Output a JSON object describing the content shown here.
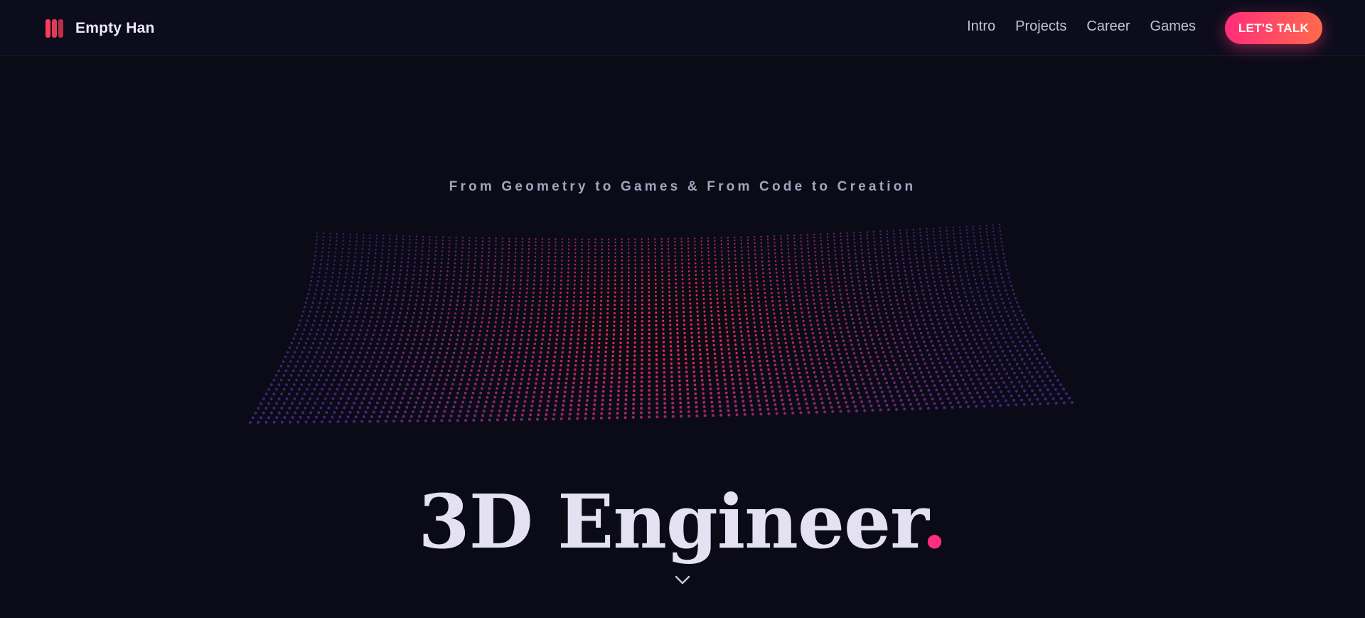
{
  "header": {
    "brand_name": "Empty Han",
    "logo_icon": "logo-bars-icon",
    "nav": [
      {
        "label": "Intro"
      },
      {
        "label": "Projects"
      },
      {
        "label": "Career"
      },
      {
        "label": "Games"
      }
    ],
    "cta_label": "LET'S TALK"
  },
  "hero": {
    "tagline": "From Geometry to Games & From Code to Creation",
    "title": "3D Engineer",
    "title_accent": ".",
    "scroll_icon": "chevron-down-icon"
  },
  "colors": {
    "background": "#0b0b18",
    "accent_pink": "#ff2e7e",
    "cta_gradient_start": "#ff2d7a",
    "cta_gradient_end": "#ff6a4d",
    "grid_center": "#ff2b4f",
    "grid_edge": "#3f3cf0"
  }
}
